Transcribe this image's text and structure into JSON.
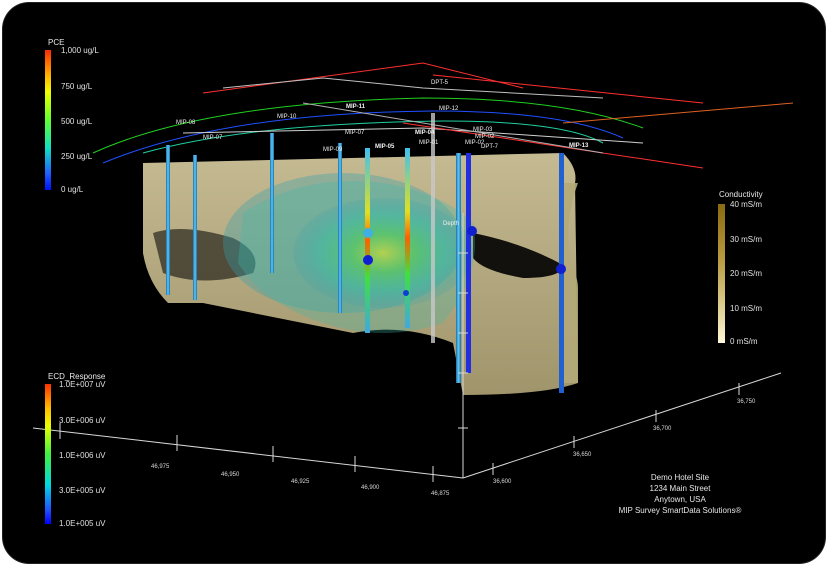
{
  "legends": {
    "pce": {
      "title": "PCE",
      "labels": [
        "1,000 ug/L",
        "750 ug/L",
        "500 ug/L",
        "250 ug/L",
        "0 ug/L"
      ]
    },
    "ecd": {
      "title": "ECD_Response",
      "labels": [
        "1.0E+007 uV",
        "3.0E+006 uV",
        "1.0E+006 uV",
        "3.0E+005 uV",
        "1.0E+005 uV"
      ]
    },
    "conductivity": {
      "title": "Conductivity",
      "labels": [
        "40 mS/m",
        "30 mS/m",
        "20 mS/m",
        "10 mS/m",
        "0 mS/m"
      ]
    }
  },
  "site": {
    "name": "Demo Hotel Site",
    "address": "1234 Main Street",
    "city": "Anytown, USA",
    "company": "MIP Survey SmartData Solutions®"
  },
  "axes": {
    "x_ticks": [
      "46,975",
      "46,950",
      "46,925",
      "46,900",
      "46,875"
    ],
    "y_ticks": [
      "36,600",
      "36,650",
      "36,700",
      "36,750"
    ]
  },
  "wells": [
    "DPT-5",
    "MIP-11",
    "MIP-12",
    "MIP-08",
    "MIP-10",
    "MIP-07",
    "MIP-09",
    "MIP-07",
    "MIP-04",
    "MIP-05",
    "MIP-03",
    "MIP-02",
    "MIP-02",
    "MIP-01",
    "DPT-7",
    "MIP-13",
    "Depth"
  ],
  "colors": {
    "background": "#000000",
    "soil": "#c8bc8c",
    "well": "#40a8e0",
    "frame": "#ffffff"
  }
}
